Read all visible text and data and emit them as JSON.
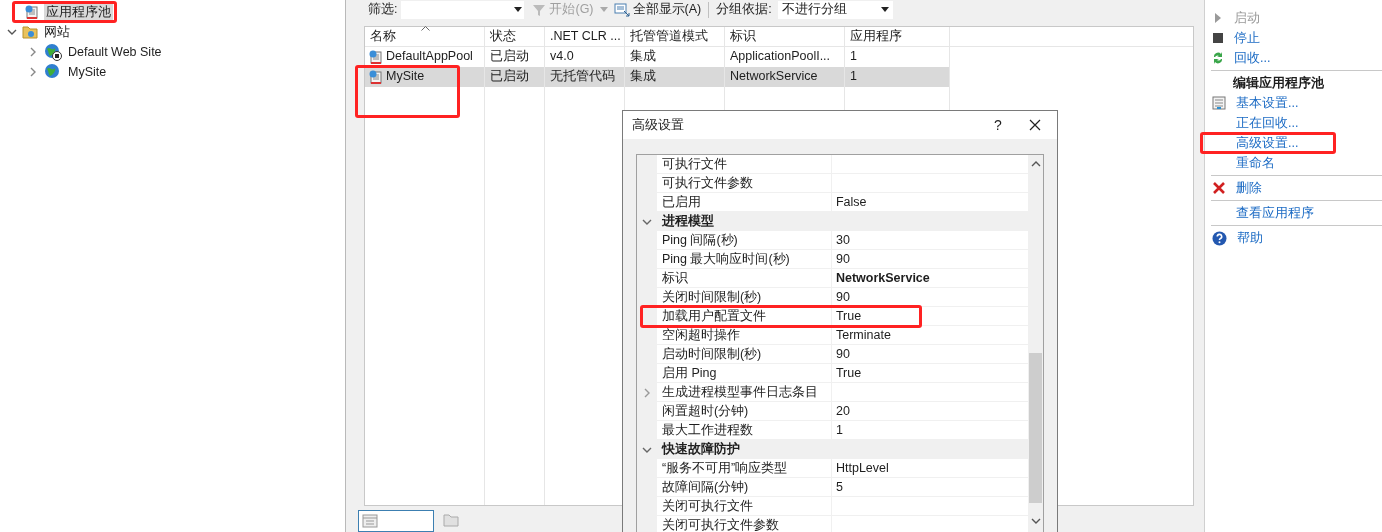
{
  "tree": [
    {
      "label": "应用程序池",
      "selected": true,
      "kind": "pool"
    },
    {
      "label": "网站",
      "selected": false,
      "kind": "folder",
      "expanded": true,
      "children": [
        {
          "label": "Default Web Site",
          "selected": false,
          "kind": "stopped-site",
          "expanded": false
        },
        {
          "label": "MySite",
          "selected": false,
          "kind": "site",
          "expanded": false
        }
      ]
    }
  ],
  "toolbar": {
    "filter_label": "筛选:",
    "start": "开始(G)",
    "start_disabled": true,
    "show_all": "全部显示(A)",
    "group_label": "分组依据:",
    "group_value": "不进行分组"
  },
  "table": {
    "columns": [
      "名称",
      "状态",
      ".NET CLR ...",
      "托管管道模式",
      "标识",
      "应用程序"
    ],
    "rows": [
      {
        "selected": false,
        "cells": [
          "DefaultAppPool",
          "已启动",
          "v4.0",
          "集成",
          "ApplicationPoolI...",
          "1"
        ]
      },
      {
        "selected": true,
        "cells": [
          "MySite",
          "已启动",
          "无托管代码",
          "集成",
          "NetworkService",
          "1"
        ]
      }
    ]
  },
  "bottom_tabs": [
    {
      "selected": true
    },
    {
      "selected": false
    }
  ],
  "actions": {
    "sections": [
      {
        "items": [
          {
            "label": "启动",
            "kind": "play",
            "disabled": true
          },
          {
            "label": "停止",
            "kind": "stop",
            "disabled": false
          },
          {
            "label": "回收...",
            "kind": "recycle",
            "disabled": false
          }
        ]
      },
      {
        "title": "编辑应用程序池",
        "items": [
          {
            "label": "基本设置...",
            "kind": "form",
            "disabled": false
          },
          {
            "label": "正在回收...",
            "kind": "link",
            "disabled": false
          },
          {
            "label": "高级设置...",
            "kind": "link",
            "disabled": false
          },
          {
            "label": "重命名",
            "kind": "link",
            "disabled": false
          }
        ]
      },
      {
        "items": [
          {
            "label": "删除",
            "kind": "delete",
            "disabled": false
          }
        ]
      },
      {
        "items": [
          {
            "label": "查看应用程序",
            "kind": "link",
            "disabled": false
          }
        ]
      },
      {
        "items": [
          {
            "label": "帮助",
            "kind": "help",
            "disabled": false
          }
        ]
      }
    ]
  },
  "dialog": {
    "title": "高级设置",
    "help": "?",
    "rows": [
      {
        "kind": "property",
        "name": "可执行文件",
        "value": ""
      },
      {
        "kind": "property",
        "name": "可执行文件参数",
        "value": ""
      },
      {
        "kind": "property",
        "name": "已启用",
        "value": "False"
      },
      {
        "kind": "category",
        "name": "进程模型",
        "expanded": true
      },
      {
        "kind": "property",
        "name": "Ping 间隔(秒)",
        "value": "30"
      },
      {
        "kind": "property",
        "name": "Ping 最大响应时间(秒)",
        "value": "90"
      },
      {
        "kind": "property",
        "name": "标识",
        "value": "NetworkService",
        "modified": true
      },
      {
        "kind": "property",
        "name": "关闭时间限制(秒)",
        "value": "90"
      },
      {
        "kind": "property",
        "name": "加载用户配置文件",
        "value": "True"
      },
      {
        "kind": "property",
        "name": "空闲超时操作",
        "value": "Terminate"
      },
      {
        "kind": "property",
        "name": "启动时间限制(秒)",
        "value": "90"
      },
      {
        "kind": "property",
        "name": "启用 Ping",
        "value": "True"
      },
      {
        "kind": "group",
        "name": "生成进程模型事件日志条目",
        "expanded": false
      },
      {
        "kind": "property",
        "name": "闲置超时(分钟)",
        "value": "20"
      },
      {
        "kind": "property",
        "name": "最大工作进程数",
        "value": "1"
      },
      {
        "kind": "category",
        "name": "快速故障防护",
        "expanded": true
      },
      {
        "kind": "property",
        "name": "“服务不可用”响应类型",
        "value": "HttpLevel"
      },
      {
        "kind": "property",
        "name": "故障间隔(分钟)",
        "value": "5"
      },
      {
        "kind": "property",
        "name": "关闭可执行文件",
        "value": ""
      },
      {
        "kind": "property",
        "name": "关闭可执行文件参数",
        "value": ""
      }
    ]
  }
}
